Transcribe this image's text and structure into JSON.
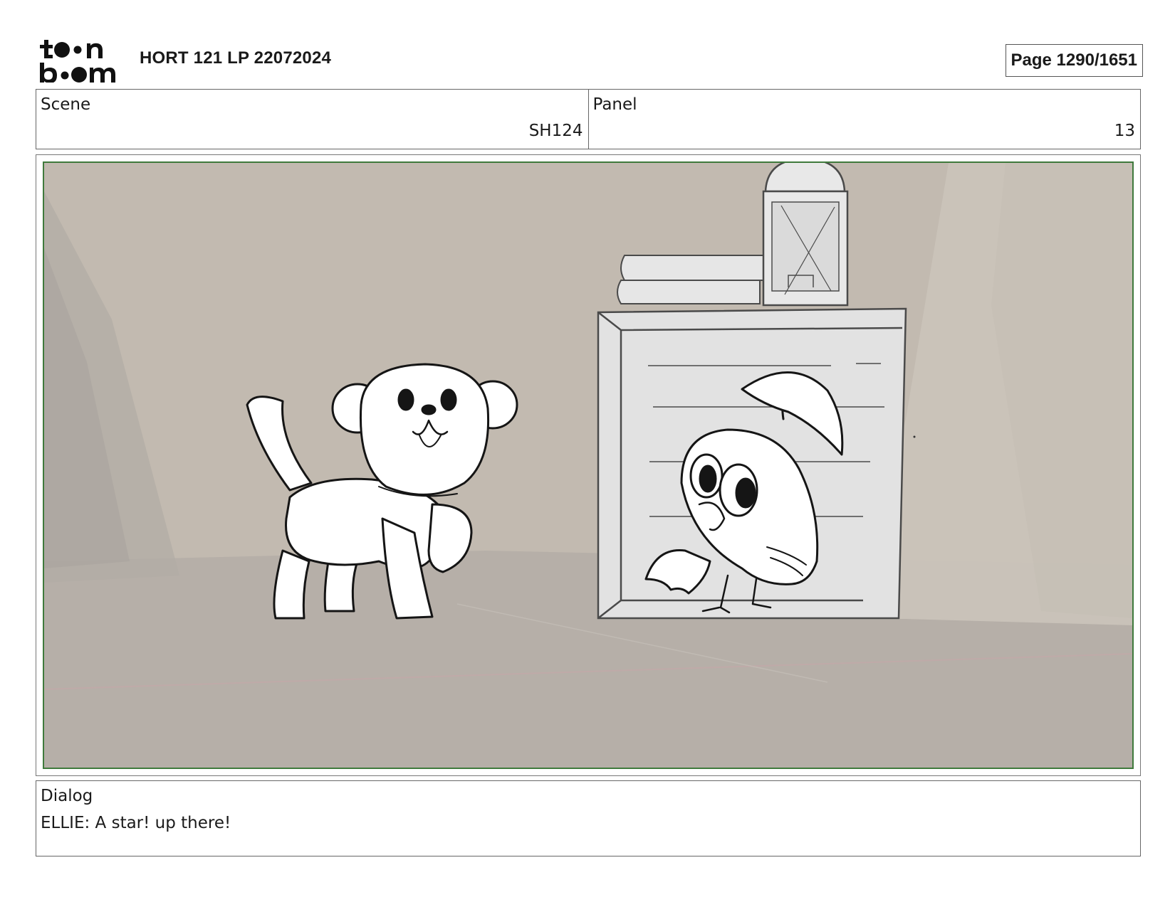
{
  "header": {
    "logo_text": "toonboom",
    "project_title": "HORT 121 LP 22072024",
    "page_indicator": "Page 1290/1651"
  },
  "scene": {
    "label": "Scene",
    "value": "SH124"
  },
  "panel": {
    "label": "Panel",
    "value": "13"
  },
  "dialog": {
    "label": "Dialog",
    "text": "ELLIE: A star! up there!"
  },
  "colors": {
    "panel_border": "#3f7a3c",
    "background_wall": "#c2bab0",
    "floor": "#b6afa8"
  }
}
